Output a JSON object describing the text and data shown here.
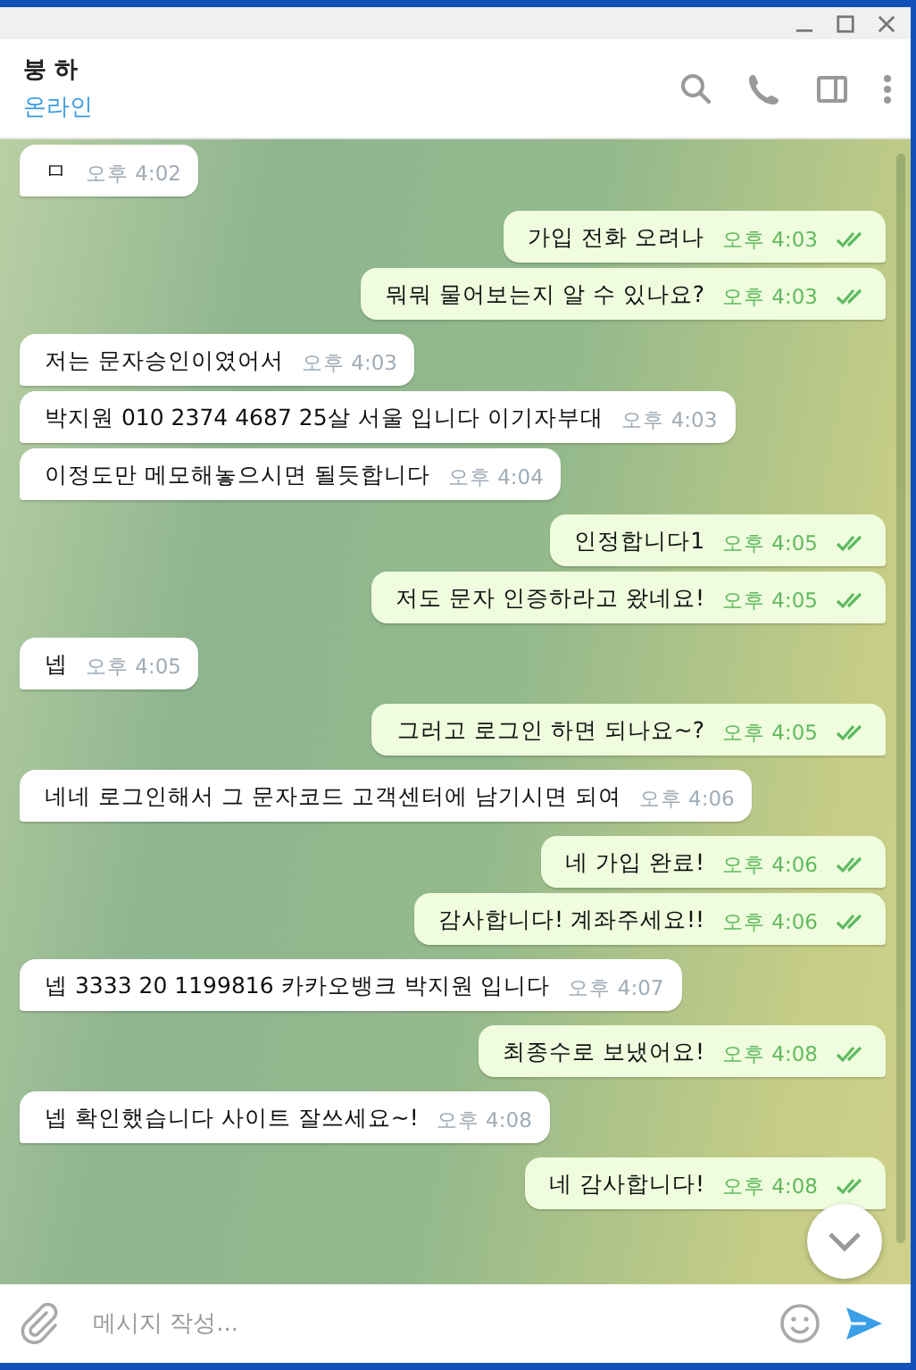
{
  "header": {
    "name": "붕 하",
    "status": "온라인"
  },
  "messages": [
    {
      "kind": "in",
      "text": "ㅁ",
      "time": "오후 4:02"
    },
    {
      "kind": "out",
      "text": "가입 전화 오려나",
      "time": "오후 4:03",
      "read": true
    },
    {
      "kind": "out",
      "text": "뭐뭐 물어보는지 알 수 있나요?",
      "time": "오후 4:03",
      "read": true
    },
    {
      "kind": "in",
      "text": "저는 문자승인이였어서",
      "time": "오후 4:03"
    },
    {
      "kind": "in",
      "text": "박지원 010 2374 4687 25살 서울 입니다 이기자부대",
      "time": "오후 4:03"
    },
    {
      "kind": "in",
      "text": "이정도만 메모해놓으시면 될듯합니다",
      "time": "오후 4:04"
    },
    {
      "kind": "out",
      "text": "인정합니다1",
      "time": "오후 4:05",
      "read": true
    },
    {
      "kind": "out",
      "text": "저도 문자 인증하라고 왔네요!",
      "time": "오후 4:05",
      "read": true
    },
    {
      "kind": "in",
      "text": "넵",
      "time": "오후 4:05"
    },
    {
      "kind": "out",
      "text": "그러고 로그인 하면 되나요~?",
      "time": "오후 4:05",
      "read": true
    },
    {
      "kind": "in",
      "text": "네네 로그인해서 그 문자코드 고객센터에 남기시면 되여",
      "time": "오후 4:06"
    },
    {
      "kind": "out",
      "text": "네 가입 완료!",
      "time": "오후 4:06",
      "read": true
    },
    {
      "kind": "out",
      "text": "감사합니다! 계좌주세요!!",
      "time": "오후 4:06",
      "read": true
    },
    {
      "kind": "in",
      "text": "넵 3333 20 1199816 카카오뱅크 박지원 입니다",
      "time": "오후 4:07"
    },
    {
      "kind": "out",
      "text": "최종수로 보냈어요!",
      "time": "오후 4:08",
      "read": true
    },
    {
      "kind": "in",
      "text": "넵 확인했습니다 사이트 잘쓰세요~!",
      "time": "오후 4:08"
    },
    {
      "kind": "out",
      "text": "네 감사합니다!",
      "time": "오후 4:08",
      "read": true
    }
  ],
  "composer": {
    "placeholder": "메시지 작성..."
  }
}
